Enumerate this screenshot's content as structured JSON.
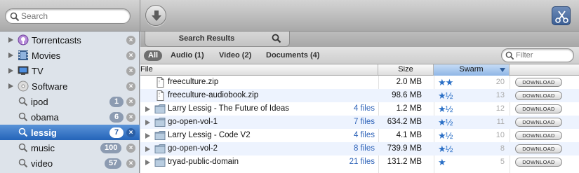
{
  "search": {
    "placeholder": "Search"
  },
  "sidebar": {
    "items": [
      {
        "label": "Torrentcasts",
        "icon": "podcast-icon"
      },
      {
        "label": "Movies",
        "icon": "film-icon"
      },
      {
        "label": "TV",
        "icon": "tv-icon"
      },
      {
        "label": "Software",
        "icon": "disc-icon"
      },
      {
        "label": "ipod",
        "count": "1",
        "icon": "search-icon"
      },
      {
        "label": "obama",
        "count": "6",
        "icon": "search-icon"
      },
      {
        "label": "lessig",
        "count": "7",
        "icon": "search-icon",
        "selected": true
      },
      {
        "label": "music",
        "count": "100",
        "icon": "search-icon"
      },
      {
        "label": "video",
        "count": "57",
        "icon": "search-icon"
      }
    ]
  },
  "main": {
    "tab_label": "Search Results",
    "filters": [
      "All",
      "Audio (1)",
      "Video (2)",
      "Documents (4)"
    ],
    "filter_placeholder": "Filter",
    "columns": {
      "file": "File",
      "size": "Size",
      "swarm": "Swarm"
    },
    "rows": [
      {
        "name": "freeculture.zip",
        "type": "file",
        "files": "",
        "size": "2.0 MB",
        "stars": "★★",
        "seeds": "20",
        "button": "DOWNLOAD"
      },
      {
        "name": "freeculture-audiobook.zip",
        "type": "file",
        "files": "",
        "size": "98.6 MB",
        "stars": "★½",
        "seeds": "13",
        "button": "DOWNLOAD"
      },
      {
        "name": "Larry Lessig - The Future of Ideas",
        "type": "folder",
        "files": "4 files",
        "size": "1.2 MB",
        "stars": "★½",
        "seeds": "12",
        "button": "DOWNLOAD"
      },
      {
        "name": "go-open-vol-1",
        "type": "folder",
        "files": "7 files",
        "size": "634.2 MB",
        "stars": "★½",
        "seeds": "11",
        "button": "DOWNLOAD"
      },
      {
        "name": "Larry Lessig - Code V2",
        "type": "folder",
        "files": "4 files",
        "size": "4.1 MB",
        "stars": "★½",
        "seeds": "10",
        "button": "DOWNLOAD"
      },
      {
        "name": "go-open-vol-2",
        "type": "folder",
        "files": "8 files",
        "size": "739.9 MB",
        "stars": "★½",
        "seeds": "8",
        "button": "DOWNLOAD"
      },
      {
        "name": "tryad-public-domain",
        "type": "folder",
        "files": "21 files",
        "size": "131.2 MB",
        "stars": "★",
        "seeds": "5",
        "button": "DOWNLOAD"
      }
    ]
  },
  "colors": {
    "selection": "#2f6ec4",
    "accent_blue": "#2a6fc6",
    "sidebar_bg": "#dde3ea"
  }
}
